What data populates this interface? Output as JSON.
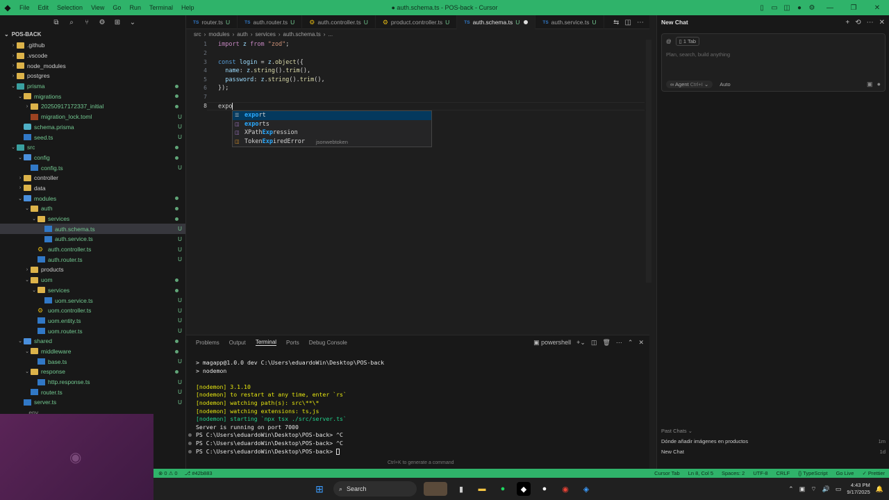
{
  "titlebar": {
    "menu": [
      "File",
      "Edit",
      "Selection",
      "View",
      "Go",
      "Run",
      "Terminal",
      "Help"
    ],
    "title": "● auth.schema.ts - POS-back - Cursor"
  },
  "sidebar": {
    "title": "POS-BACK",
    "items": [
      {
        "label": ".github",
        "depth": 1,
        "type": "folder",
        "chev": "›",
        "badge": ""
      },
      {
        "label": ".vscode",
        "depth": 1,
        "type": "folder",
        "chev": "›",
        "badge": ""
      },
      {
        "label": "node_modules",
        "depth": 1,
        "type": "folder",
        "chev": "›",
        "badge": ""
      },
      {
        "label": "postgres",
        "depth": 1,
        "type": "folder",
        "chev": "›",
        "badge": ""
      },
      {
        "label": "prisma",
        "depth": 1,
        "type": "folder-teal",
        "chev": "⌄",
        "badge": "",
        "green": true
      },
      {
        "label": "migrations",
        "depth": 2,
        "type": "folder",
        "chev": "⌄",
        "badge": "",
        "green": true
      },
      {
        "label": "20250917172337_initial",
        "depth": 3,
        "type": "folder",
        "chev": "›",
        "badge": "",
        "green": true
      },
      {
        "label": "migration_lock.toml",
        "depth": 3,
        "type": "toml",
        "chev": "",
        "badge": "U",
        "green": true
      },
      {
        "label": "schema.prisma",
        "depth": 2,
        "type": "prisma",
        "chev": "",
        "badge": "U",
        "green": true
      },
      {
        "label": "seed.ts",
        "depth": 2,
        "type": "ts",
        "chev": "",
        "badge": "U",
        "green": true
      },
      {
        "label": "src",
        "depth": 1,
        "type": "folder-teal",
        "chev": "⌄",
        "badge": "",
        "green": true
      },
      {
        "label": "config",
        "depth": 2,
        "type": "folder-blue",
        "chev": "⌄",
        "badge": "",
        "green": true
      },
      {
        "label": "config.ts",
        "depth": 3,
        "type": "ts",
        "chev": "",
        "badge": "U",
        "green": true
      },
      {
        "label": "controller",
        "depth": 2,
        "type": "folder",
        "chev": "›",
        "badge": ""
      },
      {
        "label": "data",
        "depth": 2,
        "type": "folder",
        "chev": "›",
        "badge": ""
      },
      {
        "label": "modules",
        "depth": 2,
        "type": "folder-blue",
        "chev": "⌄",
        "badge": "",
        "green": true
      },
      {
        "label": "auth",
        "depth": 3,
        "type": "folder",
        "chev": "⌄",
        "badge": "",
        "green": true
      },
      {
        "label": "services",
        "depth": 4,
        "type": "folder",
        "chev": "⌄",
        "badge": "",
        "green": true
      },
      {
        "label": "auth.schema.ts",
        "depth": 5,
        "type": "ts",
        "chev": "",
        "badge": "U",
        "green": true,
        "selected": true
      },
      {
        "label": "auth.service.ts",
        "depth": 5,
        "type": "ts",
        "chev": "",
        "badge": "U",
        "green": true
      },
      {
        "label": "auth.controller.ts",
        "depth": 4,
        "type": "gear",
        "chev": "",
        "badge": "U",
        "green": true
      },
      {
        "label": "auth.router.ts",
        "depth": 4,
        "type": "ts",
        "chev": "",
        "badge": "U",
        "green": true
      },
      {
        "label": "products",
        "depth": 3,
        "type": "folder",
        "chev": "›",
        "badge": ""
      },
      {
        "label": "uom",
        "depth": 3,
        "type": "folder",
        "chev": "⌄",
        "badge": "",
        "green": true
      },
      {
        "label": "services",
        "depth": 4,
        "type": "folder",
        "chev": "⌄",
        "badge": "",
        "green": true
      },
      {
        "label": "uom.service.ts",
        "depth": 5,
        "type": "ts",
        "chev": "",
        "badge": "U",
        "green": true
      },
      {
        "label": "uom.controller.ts",
        "depth": 4,
        "type": "gear",
        "chev": "",
        "badge": "U",
        "green": true
      },
      {
        "label": "uom.entity.ts",
        "depth": 4,
        "type": "ts",
        "chev": "",
        "badge": "U",
        "green": true
      },
      {
        "label": "uom.router.ts",
        "depth": 4,
        "type": "ts",
        "chev": "",
        "badge": "U",
        "green": true
      },
      {
        "label": "shared",
        "depth": 2,
        "type": "folder-blue",
        "chev": "⌄",
        "badge": "",
        "green": true
      },
      {
        "label": "middleware",
        "depth": 3,
        "type": "folder",
        "chev": "⌄",
        "badge": "",
        "green": true
      },
      {
        "label": "base.ts",
        "depth": 4,
        "type": "ts",
        "chev": "",
        "badge": "U",
        "green": true
      },
      {
        "label": "response",
        "depth": 3,
        "type": "folder",
        "chev": "⌄",
        "badge": "",
        "green": true
      },
      {
        "label": "http.response.ts",
        "depth": 4,
        "type": "ts",
        "chev": "",
        "badge": "U",
        "green": true
      },
      {
        "label": "router.ts",
        "depth": 3,
        "type": "ts",
        "chev": "",
        "badge": "U",
        "green": true
      },
      {
        "label": "server.ts",
        "depth": 2,
        "type": "ts",
        "chev": "",
        "badge": "U",
        "green": true
      },
      {
        "label": ".env",
        "depth": 1,
        "type": "dot",
        "chev": "",
        "badge": "",
        "dim": true
      }
    ]
  },
  "tabs": [
    {
      "label": "router.ts",
      "mod": "U",
      "icon": "ts"
    },
    {
      "label": "auth.router.ts",
      "mod": "U",
      "icon": "ts"
    },
    {
      "label": "auth.controller.ts",
      "mod": "U",
      "icon": "gear"
    },
    {
      "label": "product.controller.ts",
      "mod": "U",
      "icon": "gear"
    },
    {
      "label": "auth.schema.ts",
      "mod": "U",
      "icon": "ts",
      "active": true,
      "dirty": true
    },
    {
      "label": "auth.service.ts",
      "mod": "U",
      "icon": "ts"
    }
  ],
  "breadcrumb": [
    "src",
    "modules",
    "auth",
    "services",
    "auth.schema.ts",
    "..."
  ],
  "editor": {
    "line_numbers": [
      "1",
      "2",
      "3",
      "4",
      "5",
      "6",
      "7",
      "8"
    ],
    "current_line": "8",
    "typed_text": "expo"
  },
  "suggestions": [
    {
      "icon": "kw",
      "prefix": "",
      "match": "expo",
      "rest": "rt",
      "detail": ""
    },
    {
      "icon": "var",
      "prefix": "",
      "match": "expo",
      "rest": "rts",
      "detail": ""
    },
    {
      "icon": "var",
      "prefix": "XPath",
      "match": "Exp",
      "rest": "ression",
      "detail": ""
    },
    {
      "icon": "cls",
      "prefix": "Token",
      "match": "Exp",
      "rest": "iredError",
      "detail": "jsonwebtoken"
    }
  ],
  "chat": {
    "title": "New Chat",
    "tab_chip": "1 Tab",
    "placeholder": "Plan, search, build anything",
    "agent_label": "Agent",
    "agent_shortcut": "Ctrl+I",
    "mode": "Auto",
    "past_header": "Past Chats",
    "past_chats": [
      {
        "title": "Dónde añadir imágenes en productos",
        "age": "1m"
      },
      {
        "title": "New Chat",
        "age": "1d"
      }
    ]
  },
  "panel": {
    "tabs": [
      "Problems",
      "Output",
      "Terminal",
      "Ports",
      "Debug Console"
    ],
    "active_tab": "Terminal",
    "shell": "powershell",
    "hint": "Ctrl+K to generate a command"
  },
  "terminal": [
    {
      "text": "> magapp@1.0.0 dev C:\\Users\\eduardoWin\\Desktop\\POS-back",
      "cls": "t-white",
      "mark": false
    },
    {
      "text": "> nodemon",
      "cls": "t-white",
      "mark": false
    },
    {
      "text": "",
      "cls": "t-white",
      "mark": false
    },
    {
      "text": "[nodemon] 3.1.10",
      "cls": "t-yellow",
      "mark": false
    },
    {
      "text": "[nodemon] to restart at any time, enter `rs`",
      "cls": "t-yellow",
      "mark": false
    },
    {
      "text": "[nodemon] watching path(s): src\\**\\*",
      "cls": "t-yellow",
      "mark": false
    },
    {
      "text": "[nodemon] watching extensions: ts,js",
      "cls": "t-yellow",
      "mark": false
    },
    {
      "text": "[nodemon] starting `npx tsx ./src/server.ts`",
      "cls": "t-green",
      "mark": false
    },
    {
      "text": "Server is running on port 7000",
      "cls": "t-white",
      "mark": false
    },
    {
      "text": "PS C:\\Users\\eduardoWin\\Desktop\\POS-back> ^C",
      "cls": "t-white",
      "mark": true
    },
    {
      "text": "PS C:\\Users\\eduardoWin\\Desktop\\POS-back> ^C",
      "cls": "t-white",
      "mark": true
    },
    {
      "text": "PS C:\\Users\\eduardoWin\\Desktop\\POS-back> ",
      "cls": "t-white",
      "mark": true
    }
  ],
  "statusbar": {
    "left": [
      "⊗ 0 ⚠ 0",
      "⎇ #42b883"
    ],
    "right": [
      "Cursor Tab",
      "Ln 8, Col 5",
      "Spaces: 2",
      "UTF-8",
      "CRLF",
      "{} TypeScript",
      "Go Live",
      "✓ Prettier"
    ]
  },
  "taskbar": {
    "search_label": "Search",
    "time": "4:43 PM",
    "date": "9/17/2025"
  }
}
